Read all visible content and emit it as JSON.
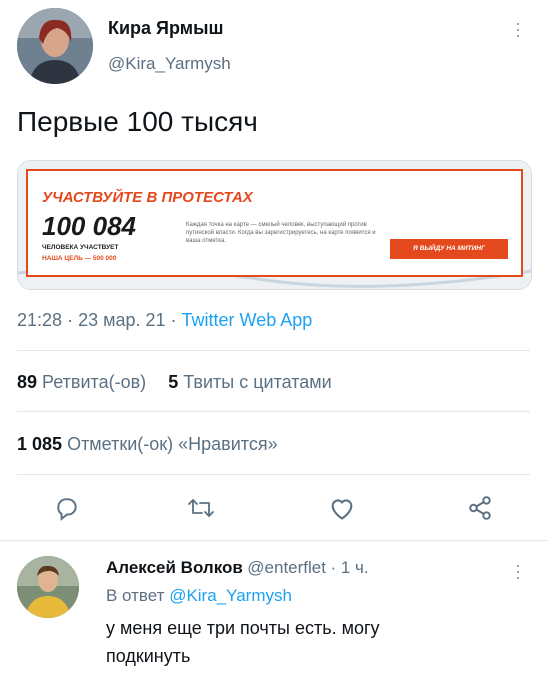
{
  "tweet": {
    "author_name": "Кира Ярмыш",
    "author_handle": "@Kira_Yarmysh",
    "text": "Первые 100 тысяч",
    "card": {
      "title": "УЧАСТВУЙТЕ В ПРОТЕСТАХ",
      "count": "100 084",
      "count_label": "ЧЕЛОВЕКА УЧАСТВУЕТ",
      "goal": "НАША ЦЕЛЬ — 500 000",
      "description": "Каждая точка на карте — смелый человек, выступающий против путинской власти. Когда вы зарегистрируетесь, на карте появится и ваша отметка.",
      "button": "Я ВЫЙДУ НА МИТИНГ",
      "accent": "#e4491d"
    },
    "time": "21:28",
    "date": "23 мар. 21",
    "source": "Twitter Web App",
    "retweets_count": "89",
    "retweets_label": "Ретвита(-ов)",
    "quotes_count": "5",
    "quotes_label": "Твиты с цитатами",
    "likes_count": "1 085",
    "likes_label": "Отметки(-ок) «Нравится»",
    "actions": [
      "reply-icon",
      "retweet-icon",
      "like-icon",
      "share-icon"
    ]
  },
  "reply": {
    "author_name": "Алексей Волков",
    "author_handle": "@enterflet",
    "time_ago": "1 ч.",
    "reply_to_prefix": "В ответ",
    "reply_to_handle": "@Kira_Yarmysh",
    "text": "у меня еще три почты есть. могу подкинуть"
  },
  "colors": {
    "link": "#1da1f2",
    "secondary": "#5b7083",
    "divider": "#e1e8ed"
  }
}
